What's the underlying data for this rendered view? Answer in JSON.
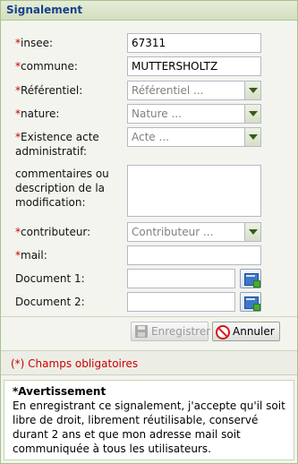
{
  "panel": {
    "title": "Signalement"
  },
  "form": {
    "required_mark": "*",
    "insee": {
      "label": "insee:",
      "value": "67311"
    },
    "commune": {
      "label": "commune:",
      "value": "MUTTERSHOLTZ"
    },
    "referentiel": {
      "label": "Référentiel:",
      "placeholder": "Référentiel ..."
    },
    "nature": {
      "label": "nature:",
      "placeholder": "Nature ..."
    },
    "existence": {
      "label_line1": "Existence acte",
      "label_line2": "administratif:",
      "placeholder": "Acte ..."
    },
    "commentaires": {
      "label_line1": "commentaires ou",
      "label_line2": "description de la",
      "label_line3": "modification:"
    },
    "contributeur": {
      "label": "contributeur:",
      "placeholder": "Contributeur ..."
    },
    "mail": {
      "label": "mail:",
      "value": ""
    },
    "document1": {
      "label": "Document 1:"
    },
    "document2": {
      "label": "Document 2:"
    }
  },
  "buttons": {
    "save": "Enregistrer",
    "cancel": "Annuler"
  },
  "mandatory_note": "(*) Champs obligatoires",
  "warning": {
    "title": "*Avertissement",
    "text": "En enregistrant ce signalement, j'accepte qu'il soit libre de droit, librement réutilisable, conservé durant 2 ans et que mon adresse mail soit communiquée à tous les utilisateurs."
  }
}
